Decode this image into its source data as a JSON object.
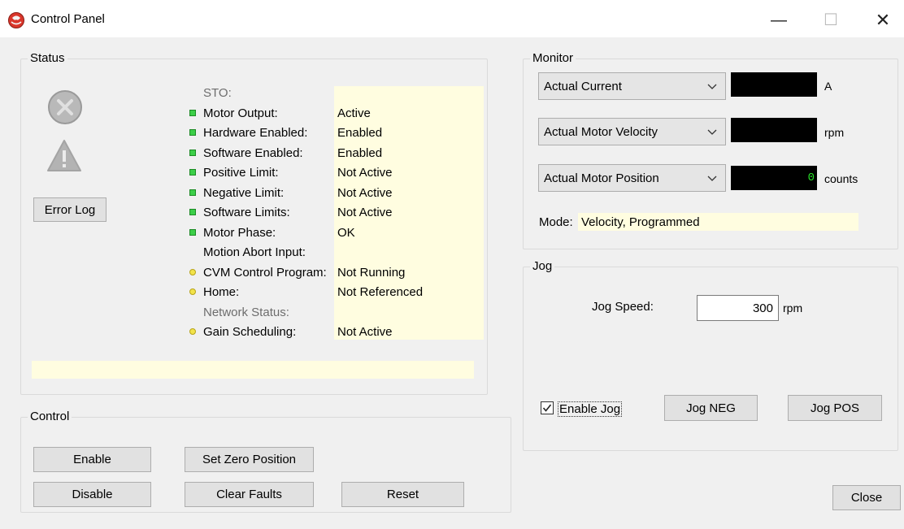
{
  "window": {
    "title": "Control Panel",
    "minimize": "—",
    "maximize": "☐",
    "close": "✕"
  },
  "status": {
    "group_label": "Status",
    "error_log_label": "Error Log",
    "rows": [
      {
        "icon": "none",
        "label": "STO:",
        "value": "",
        "muted": true
      },
      {
        "icon": "green",
        "label": "Motor Output:",
        "value": "Active"
      },
      {
        "icon": "green",
        "label": "Hardware Enabled:",
        "value": "Enabled"
      },
      {
        "icon": "green",
        "label": "Software Enabled:",
        "value": "Enabled"
      },
      {
        "icon": "green",
        "label": "Positive Limit:",
        "value": "Not Active"
      },
      {
        "icon": "green",
        "label": "Negative Limit:",
        "value": "Not Active"
      },
      {
        "icon": "green",
        "label": "Software Limits:",
        "value": "Not Active"
      },
      {
        "icon": "green",
        "label": "Motor Phase:",
        "value": "OK"
      },
      {
        "icon": "none",
        "label": "Motion Abort Input:",
        "value": ""
      },
      {
        "icon": "yellow",
        "label": "CVM Control Program:",
        "value": "Not Running"
      },
      {
        "icon": "yellow",
        "label": "Home:",
        "value": "Not Referenced"
      },
      {
        "icon": "none",
        "label": "Network Status:",
        "value": "",
        "muted": true
      },
      {
        "icon": "yellow",
        "label": "Gain Scheduling:",
        "value": "Not Active"
      }
    ],
    "message": ""
  },
  "control": {
    "group_label": "Control",
    "enable_label": "Enable",
    "disable_label": "Disable",
    "set_zero_label": "Set Zero Position",
    "clear_faults_label": "Clear Faults",
    "reset_label": "Reset"
  },
  "monitor": {
    "group_label": "Monitor",
    "channels": [
      {
        "selected": "Actual Current",
        "value": "",
        "unit": "A"
      },
      {
        "selected": "Actual Motor Velocity",
        "value": "",
        "unit": "rpm"
      },
      {
        "selected": "Actual Motor Position",
        "value": "0",
        "unit": "counts"
      }
    ],
    "mode_label": "Mode:",
    "mode_value": "Velocity, Programmed"
  },
  "jog": {
    "group_label": "Jog",
    "speed_label": "Jog Speed:",
    "speed_value": "300",
    "speed_unit": "rpm",
    "enable_label": "Enable Jog",
    "enable_checked": true,
    "jog_neg_label": "Jog NEG",
    "jog_pos_label": "Jog POS"
  },
  "footer": {
    "close_label": "Close"
  }
}
